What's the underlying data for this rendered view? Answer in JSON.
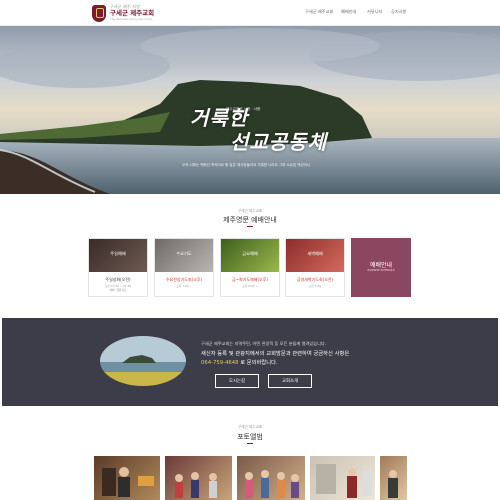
{
  "header": {
    "logo_sub": "구세군 제주 지방",
    "logo_main": "구세군 제주교회",
    "logo_en": "The Salvation Army Jeju Corps",
    "nav": [
      "구세군 제주교회",
      "예배안내",
      "커뮤니티",
      "공지사항"
    ]
  },
  "hero": {
    "small_text": "예수교회의 사명 · 사랑",
    "title_line1": "거룩한",
    "title_line2": "선교공동체",
    "caption": "오직 너희는 택하신 족속이요 왕 같은 제사장들이요 거룩한 나라요 그의 소유된 백성이니"
  },
  "worship": {
    "small": "구세군 제주교회",
    "title": "제주영문 예배안내",
    "cards": [
      {
        "thumb_label": "주일예배",
        "title": "주일성화(오전)",
        "lines": [
          "오전 10:30 ~ 11:30",
          "예배: 영문강당"
        ],
        "accent": "#4a3a36"
      },
      {
        "thumb_label": "수요기도",
        "title": "수요찬양기도회(오후)",
        "lines": [
          "오후 7:30 ~"
        ],
        "accent": "#8f8c88"
      },
      {
        "thumb_label": "금요예배",
        "title": "금~화기도예배(오후)",
        "lines": [
          "오후 8:00 ~"
        ],
        "accent": "#5f7a3a"
      },
      {
        "thumb_label": "새벽예배",
        "title": "금영새벽기도회(오전)",
        "lines": [
          "오전 5:30"
        ],
        "accent": "#b54a45"
      }
    ],
    "info_title": "예배안내",
    "info_sub": "WORSHIP SCHEDULE"
  },
  "band": {
    "line1": "구세군 제주교회는 지역주민, 어떤 관광객 등 모든 분들께 열려있습니다.",
    "line2": "새신자 등록 및 관광지에서의 교회방문과 관련하여 궁금하신 사항은",
    "phone": "064-759-4648",
    "line3_suffix": "로 문의바랍니다.",
    "btn_directions": "오시는길",
    "btn_intro": "교회소개"
  },
  "album": {
    "small": "구세군 제주교회",
    "title": "포토앨범"
  },
  "colors": {
    "brand": "#7a1d2b",
    "band": "#3d3d4a",
    "info_card": "#8c4760",
    "phone": "#e8c35a"
  }
}
